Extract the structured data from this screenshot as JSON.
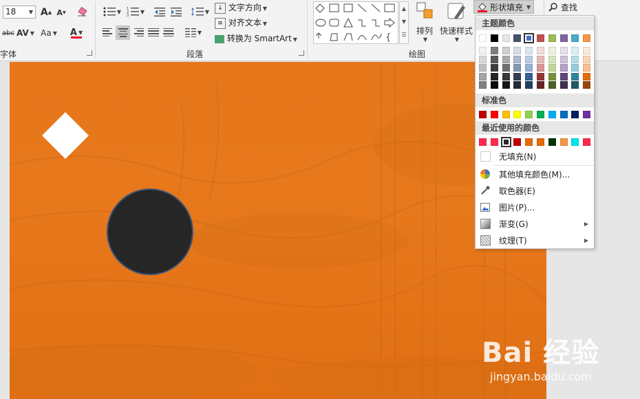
{
  "ribbon": {
    "font_group_label": "字体",
    "paragraph_group_label": "段落",
    "drawing_group_label": "绘图",
    "font_size": "18",
    "text_direction_label": "文字方向",
    "align_text_label": "对齐文本",
    "convert_smartart_label": "转换为 SmartArt",
    "arrange_label": "排列",
    "quick_styles_label": "快速样式",
    "shape_fill_label": "形状填充",
    "find_label": "查找",
    "grow_font_glyph": "A",
    "shrink_font_glyph": "A",
    "strikethrough_glyph": "abc",
    "char_spacing_glyph": "AV",
    "change_case_glyph": "Aa",
    "font_color_glyph": "A",
    "font_color": "#e81123"
  },
  "fill_menu": {
    "theme_colors_header": "主题颜色",
    "standard_colors_header": "标准色",
    "recent_colors_header": "最近使用的颜色",
    "theme_colors": [
      [
        "#ffffff",
        "#f2f2f2",
        "#d9d9d9",
        "#bfbfbf",
        "#a6a6a6",
        "#808080"
      ],
      [
        "#000000",
        "#808080",
        "#595959",
        "#404040",
        "#262626",
        "#0d0d0d"
      ],
      [
        "#e7e6e6",
        "#d0cece",
        "#aeabab",
        "#757171",
        "#3b3838",
        "#171616"
      ],
      [
        "#44546a",
        "#d6dce5",
        "#adb9ca",
        "#8497b0",
        "#333f50",
        "#222a35"
      ],
      [
        "#4472c4",
        "#dae3f3",
        "#b4c7e7",
        "#8faadc",
        "#2f5597",
        "#203864"
      ],
      [
        "#ed7d31",
        "#fbe5d6",
        "#f8cbad",
        "#f4b183",
        "#c55a11",
        "#843c0c"
      ],
      [
        "#a5a5a5",
        "#ededed",
        "#dbdbdb",
        "#c9c9c9",
        "#7c7c7c",
        "#525252"
      ],
      [
        "#ffc000",
        "#fff2cc",
        "#ffe699",
        "#ffd966",
        "#bf9000",
        "#7f6000"
      ],
      [
        "#5b9bd5",
        "#deebf7",
        "#bdd7ee",
        "#9dc3e6",
        "#2e75b6",
        "#1f4e79"
      ],
      [
        "#70ad47",
        "#e2f0d9",
        "#c5e0b4",
        "#a9d18e",
        "#548235",
        "#385723"
      ]
    ],
    "theme_top_row": [
      "#ffffff",
      "#000000",
      "#e7e6e6",
      "#44546a",
      "#4472c4",
      "#c0504d",
      "#9bbb59",
      "#8064a2",
      "#4bacc6",
      "#f79646"
    ],
    "theme_shades": [
      [
        "#f2f2f2",
        "#7f7f7f",
        "#d0cece",
        "#d6dce4",
        "#dbe5f1",
        "#f2dcdb",
        "#ebf1dd",
        "#e5e0ec",
        "#dbeef3",
        "#fde9d9"
      ],
      [
        "#d9d9d9",
        "#595959",
        "#aeaaaa",
        "#adb9ca",
        "#b8cce4",
        "#e5b9b7",
        "#d7e3bc",
        "#ccc1d9",
        "#b7dde8",
        "#fbd5b5"
      ],
      [
        "#bfbfbf",
        "#3f3f3f",
        "#757070",
        "#8496b0",
        "#95b3d7",
        "#d99694",
        "#c3d69b",
        "#b2a2c7",
        "#92cddc",
        "#fac08f"
      ],
      [
        "#a5a5a5",
        "#262626",
        "#3a3838",
        "#333f4f",
        "#366092",
        "#953734",
        "#76923c",
        "#5f497a",
        "#31859b",
        "#e36c09"
      ],
      [
        "#7f7f7f",
        "#0c0c0c",
        "#161616",
        "#222a35",
        "#244061",
        "#632423",
        "#4f6128",
        "#3f3151",
        "#205867",
        "#974806"
      ]
    ],
    "standard_colors": [
      "#c00000",
      "#ff0000",
      "#ffc000",
      "#ffff00",
      "#92d050",
      "#00b050",
      "#00b0f0",
      "#0070c0",
      "#002060",
      "#7030a0"
    ],
    "recent_colors": [
      "#ff2b4e",
      "#ff2b4e",
      "#262626",
      "#c00000",
      "#e36c09",
      "#e36c09",
      "#003300",
      "#f79646",
      "#00e5e5",
      "#ff2b4e"
    ],
    "items": [
      {
        "label": "无填充(N)",
        "icon": "no-fill-icon"
      },
      {
        "label": "其他填充颜色(M)...",
        "icon": "color-wheel-icon"
      },
      {
        "label": "取色器(E)",
        "icon": "eyedropper-icon"
      },
      {
        "label": "图片(P)...",
        "icon": "picture-icon"
      },
      {
        "label": "渐变(G)",
        "icon": "gradient-icon"
      },
      {
        "label": "纹理(T)",
        "icon": "texture-icon"
      }
    ]
  },
  "slide": {
    "background_color": "#e6761a",
    "diamond_color": "#ffffff",
    "circle_fill": "#262626",
    "circle_border": "#3c5578"
  },
  "watermark": {
    "logo_text": "Bai 经验",
    "url": "jingyan.baidu.com"
  }
}
